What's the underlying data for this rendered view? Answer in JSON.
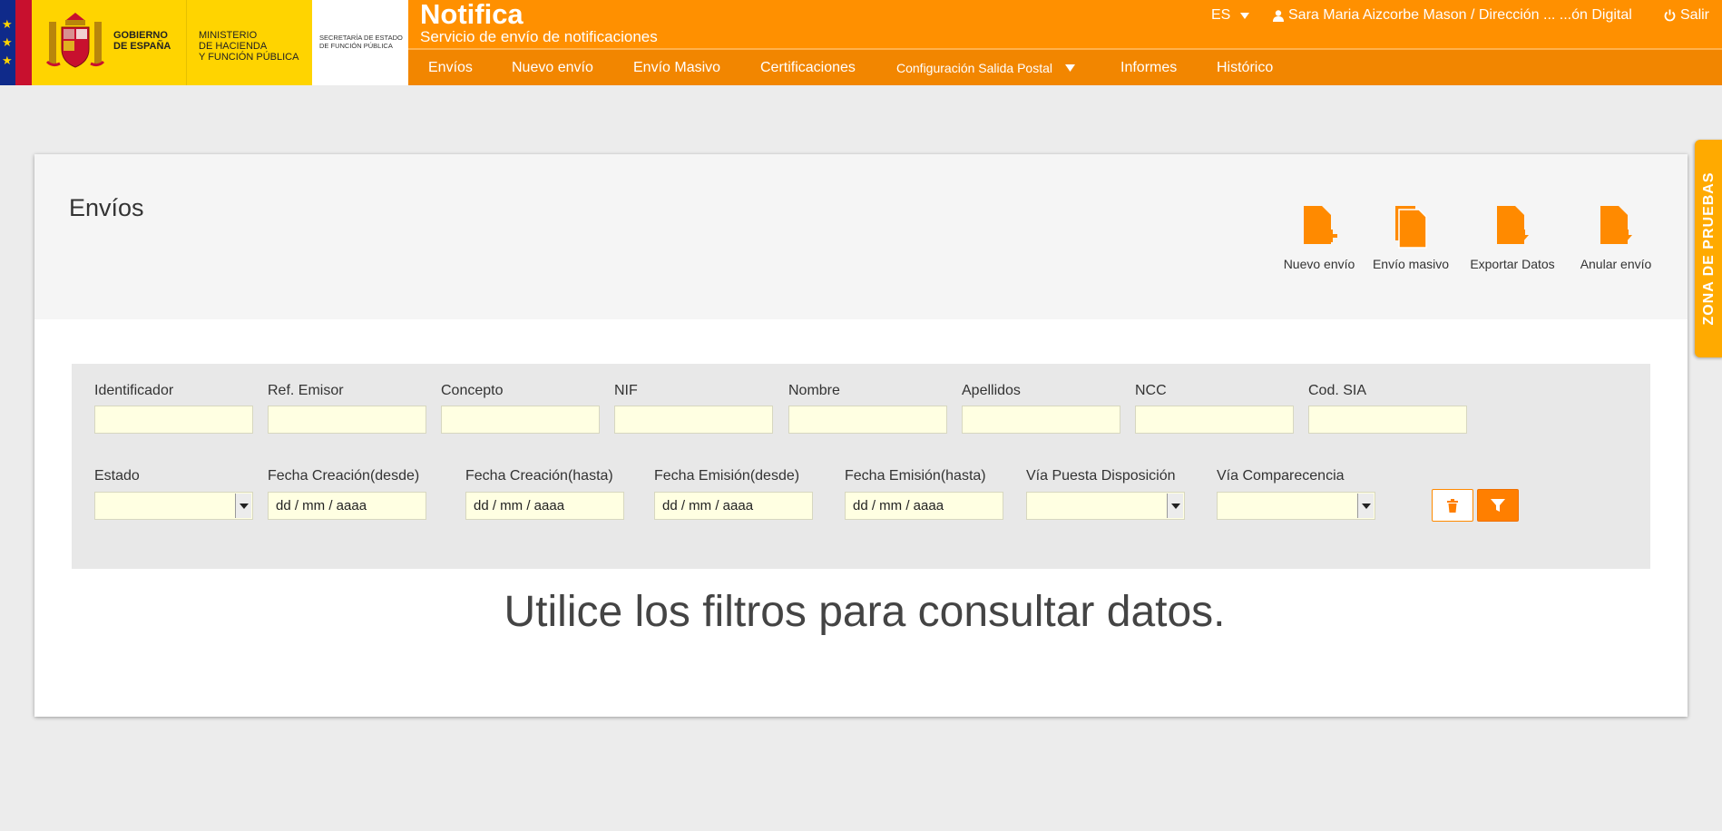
{
  "branding": {
    "gobierno": [
      "GOBIERNO",
      "DE ESPAÑA"
    ],
    "ministerio": [
      "MINISTERIO",
      "DE HACIENDA",
      "Y FUNCIÓN PÚBLICA"
    ],
    "secretaria": [
      "SECRETARÍA DE ESTADO",
      "DE FUNCIÓN PÚBLICA"
    ]
  },
  "header": {
    "app_title": "Notifica",
    "app_subtitle": "Servicio de envío de notificaciones",
    "language": "ES",
    "user": "Sara Maria Aizcorbe Mason / Dirección ... ...ón Digital",
    "logout": "Salir",
    "icons": {
      "user": "user-icon",
      "logout": "power-icon",
      "dropdown": "caret-down-icon"
    }
  },
  "nav": {
    "items": [
      "Envíos",
      "Nuevo envío",
      "Envío Masivo",
      "Certificaciones",
      "Configuración Salida Postal",
      "Informes",
      "Histórico"
    ]
  },
  "page": {
    "title": "Envíos",
    "actions": [
      "Nuevo envío",
      "Envío masivo",
      "Exportar Datos",
      "Anular envío"
    ]
  },
  "filters": {
    "row1": [
      "Identificador",
      "Ref. Emisor",
      "Concepto",
      "NIF",
      "Nombre",
      "Apellidos",
      "NCC",
      "Cod. SIA"
    ],
    "row2": [
      "Estado",
      "Fecha Creación(desde)",
      "Fecha Creación(hasta)",
      "Fecha Emisión(desde)",
      "Fecha Emisión(hasta)",
      "Vía Puesta Disposición",
      "Vía Comparecencia"
    ],
    "date_placeholder": "dd / mm / aaaa",
    "icons": {
      "clear": "trash-icon",
      "apply": "filter-icon"
    }
  },
  "empty_message": "Utilice los filtros para consultar datos.",
  "side_tab": "ZONA DE PRUEBAS",
  "colors": {
    "brand_orange": "#ff9000",
    "nav_orange": "#f28600",
    "input_bg": "#ffffe2",
    "side_tab": "#ffaa00"
  }
}
